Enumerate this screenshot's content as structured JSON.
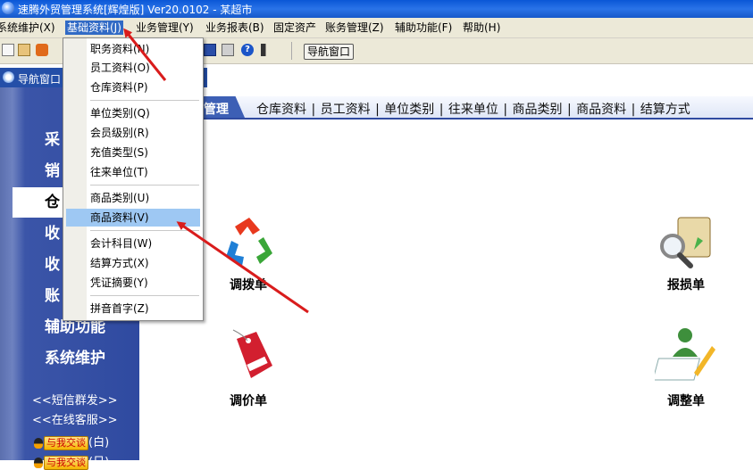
{
  "window": {
    "title": "速腾外贸管理系统[辉煌版] Ver20.0102  -  某超市"
  },
  "menubar": {
    "items": [
      {
        "label": "系统维护(X)"
      },
      {
        "label": "基础资料(J)"
      },
      {
        "label": "业务管理(Y)"
      },
      {
        "label": "业务报表(B)"
      },
      {
        "label": "固定资产"
      },
      {
        "label": "账务管理(Z)"
      },
      {
        "label": "辅助功能(F)"
      },
      {
        "label": "帮助(H)"
      }
    ]
  },
  "toolbar": {
    "nav_button": "导航窗口"
  },
  "nav_window": {
    "title": "导航窗口"
  },
  "sidebar": {
    "items": [
      {
        "label": "采"
      },
      {
        "label": "销"
      },
      {
        "label": "仓"
      },
      {
        "label": "收"
      },
      {
        "label": "收"
      },
      {
        "label": "账"
      },
      {
        "label": "辅助功能"
      },
      {
        "label": "系统维护"
      }
    ],
    "links": [
      "<<短信群发>>",
      "<<在线客服>>"
    ],
    "qq": [
      {
        "button": "与我交谈",
        "suffix": "(白)"
      },
      {
        "button": "与我交谈",
        "suffix": "(日)"
      }
    ]
  },
  "tabstrip": {
    "active": "管理",
    "links": [
      "仓库资料",
      "员工资料",
      "单位类别",
      "往来单位",
      "商品类别",
      "商品资料",
      "结算方式"
    ]
  },
  "functions": [
    {
      "label": "调拨单",
      "icon": "recycle-icon"
    },
    {
      "label": "报损单",
      "icon": "magnifier-clipboard-icon"
    },
    {
      "label": "调价单",
      "icon": "sale-tag-icon"
    },
    {
      "label": "调整单",
      "icon": "person-pencil-icon"
    }
  ],
  "dropdown": {
    "items": [
      {
        "label": "职务资料(N)"
      },
      {
        "label": "员工资料(O)"
      },
      {
        "label": "仓库资料(P)"
      },
      {
        "label": "单位类别(Q)"
      },
      {
        "label": "会员级别(R)"
      },
      {
        "label": "充值类型(S)"
      },
      {
        "label": "往来单位(T)"
      },
      {
        "label": "商品类别(U)"
      },
      {
        "label": "商品资料(V)"
      },
      {
        "label": "会计科目(W)"
      },
      {
        "label": "结算方式(X)"
      },
      {
        "label": "凭证摘要(Y)"
      },
      {
        "label": "拼音首字(Z)"
      }
    ],
    "highlighted": "商品资料(V)"
  },
  "colors": {
    "sidebar": "#2f4aa0",
    "menu_highlight": "#9ec8f3",
    "arrow": "#d91c1c",
    "title_bar": "#1658c9"
  }
}
